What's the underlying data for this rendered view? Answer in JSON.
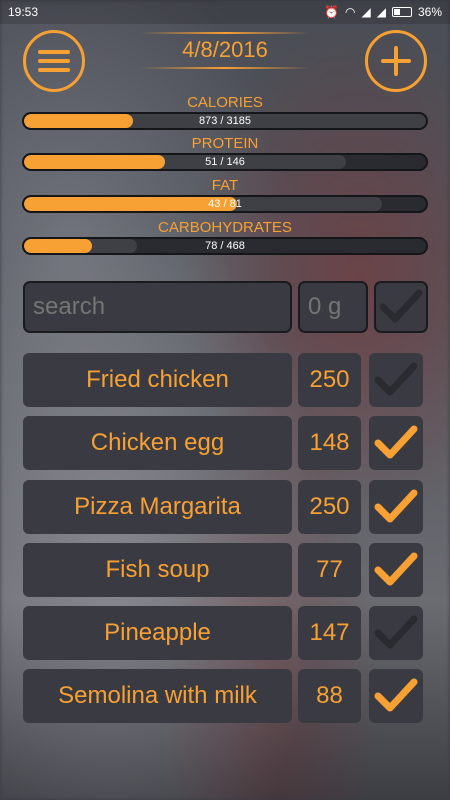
{
  "status_bar": {
    "time": "19:53",
    "battery": "36%",
    "battery_level": 0.36
  },
  "header": {
    "date": "4/8/2016",
    "menu_icon": "hamburger-menu-icon",
    "add_icon": "plus-icon"
  },
  "nutrients": [
    {
      "label": "CALORIES",
      "value_text": "873 / 3185",
      "fill": 0.27,
      "track": 1.0
    },
    {
      "label": "PROTEIN",
      "value_text": "51 / 146",
      "fill": 0.35,
      "track": 0.8
    },
    {
      "label": "FAT",
      "value_text": "43 / 81",
      "fill": 0.53,
      "track": 0.89
    },
    {
      "label": "CARBOHYDRATES",
      "value_text": "78 / 468",
      "fill": 0.17,
      "track": 0.28
    }
  ],
  "search": {
    "placeholder": "search",
    "gram_placeholder": "0 g"
  },
  "foods": [
    {
      "name": "Fried chicken",
      "amount": "250",
      "checked": false
    },
    {
      "name": "Chicken egg",
      "amount": "148",
      "checked": true
    },
    {
      "name": "Pizza Margarita",
      "amount": "250",
      "checked": true
    },
    {
      "name": "Fish soup",
      "amount": "77",
      "checked": true
    },
    {
      "name": "Pineapple",
      "amount": "147",
      "checked": false
    },
    {
      "name": "Semolina with milk",
      "amount": "88",
      "checked": true
    }
  ],
  "colors": {
    "accent": "#f7a033",
    "checked": "#f7a033",
    "unchecked": "#2a2b30"
  }
}
